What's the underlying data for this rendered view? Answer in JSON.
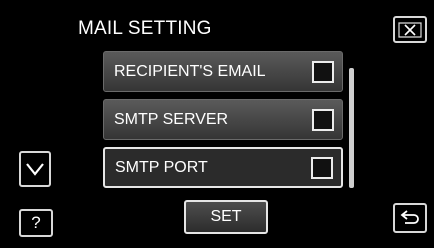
{
  "header": {
    "title": "MAIL SETTING"
  },
  "menu": {
    "items": [
      {
        "label": "RECIPIENT'S EMAIL",
        "checked": false
      },
      {
        "label": "SMTP SERVER",
        "checked": false
      },
      {
        "label": "SMTP PORT",
        "checked": false
      }
    ]
  },
  "buttons": {
    "set_label": "SET",
    "help_label": "?"
  },
  "icons": {
    "close": "close-icon",
    "down": "chevron-down-icon",
    "back": "return-icon"
  }
}
